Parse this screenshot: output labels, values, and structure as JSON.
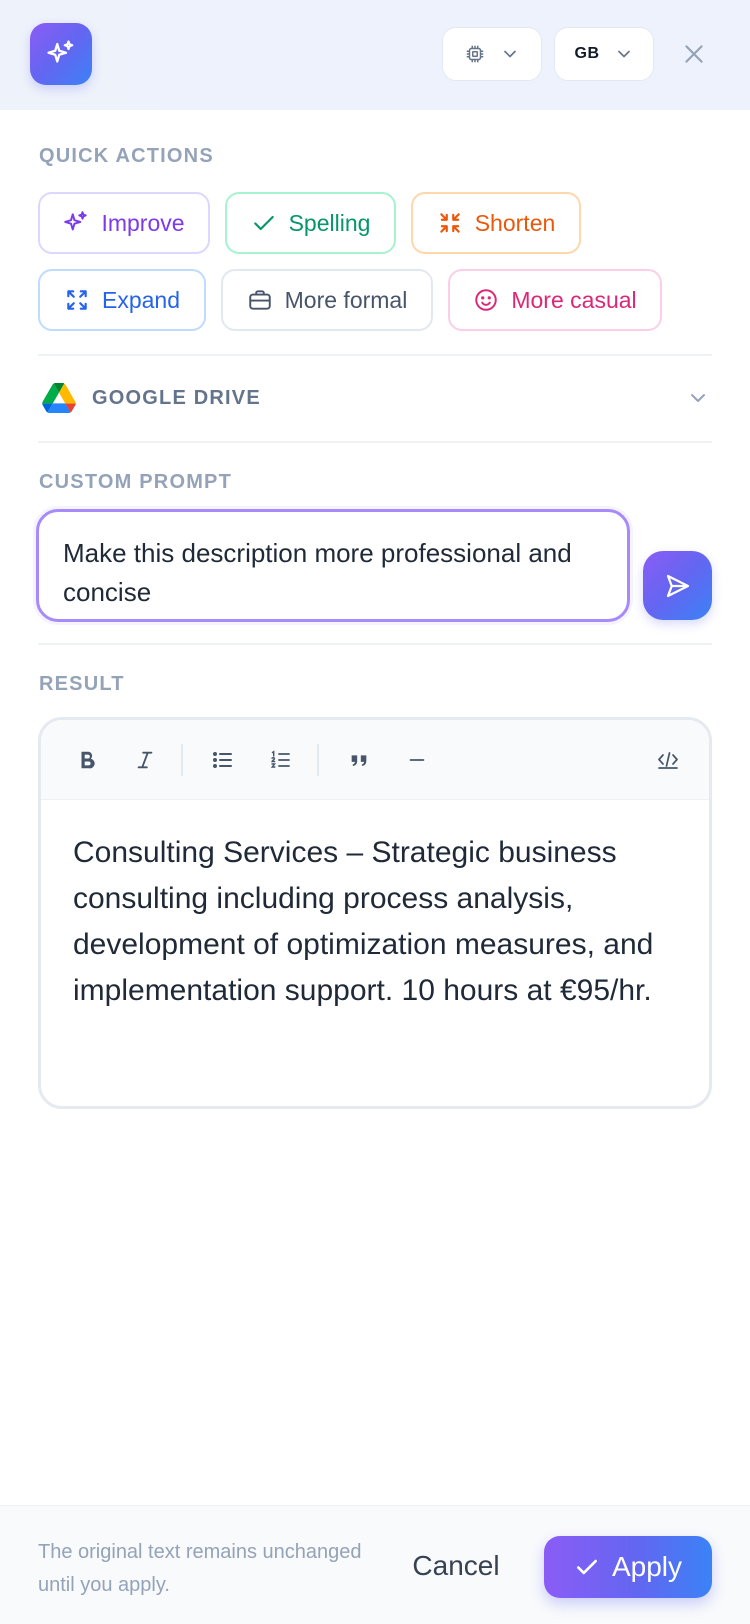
{
  "header": {
    "language_code": "GB",
    "icons": {
      "logo": "sparkles-icon",
      "model": "cpu-chip-icon",
      "close": "close-icon"
    }
  },
  "quick_actions": {
    "label": "QUICK ACTIONS",
    "items": [
      {
        "label": "Improve",
        "icon": "sparkles-icon",
        "color": "#7c3aed"
      },
      {
        "label": "Spelling",
        "icon": "check-icon",
        "color": "#059669"
      },
      {
        "label": "Shorten",
        "icon": "arrows-pointing-in-icon",
        "color": "#ea580c"
      },
      {
        "label": "Expand",
        "icon": "arrows-pointing-out-icon",
        "color": "#2563eb"
      },
      {
        "label": "More formal",
        "icon": "briefcase-icon",
        "color": "#475569"
      },
      {
        "label": "More casual",
        "icon": "smiley-face-icon",
        "color": "#db2777"
      }
    ]
  },
  "google_drive": {
    "label": "GOOGLE DRIVE",
    "expanded": false
  },
  "custom_prompt": {
    "label": "CUSTOM PROMPT",
    "value": "Make this description more professional and concise"
  },
  "result": {
    "label": "RESULT",
    "toolbar": [
      "bold",
      "italic",
      "bullet-list",
      "numbered-list",
      "blockquote",
      "horizontal-rule",
      "code-view"
    ],
    "content": "Consulting Services – Strategic business consulting including process analysis, development of optimization measures, and implementation support. 10 hours at €95/hr."
  },
  "footer": {
    "note": "The original text remains unchanged until you apply.",
    "cancel_label": "Cancel",
    "apply_label": "Apply"
  },
  "colors": {
    "accent_start": "#8b5cf6",
    "accent_end": "#3b82f6",
    "prompt_border": "#a78bfa"
  }
}
